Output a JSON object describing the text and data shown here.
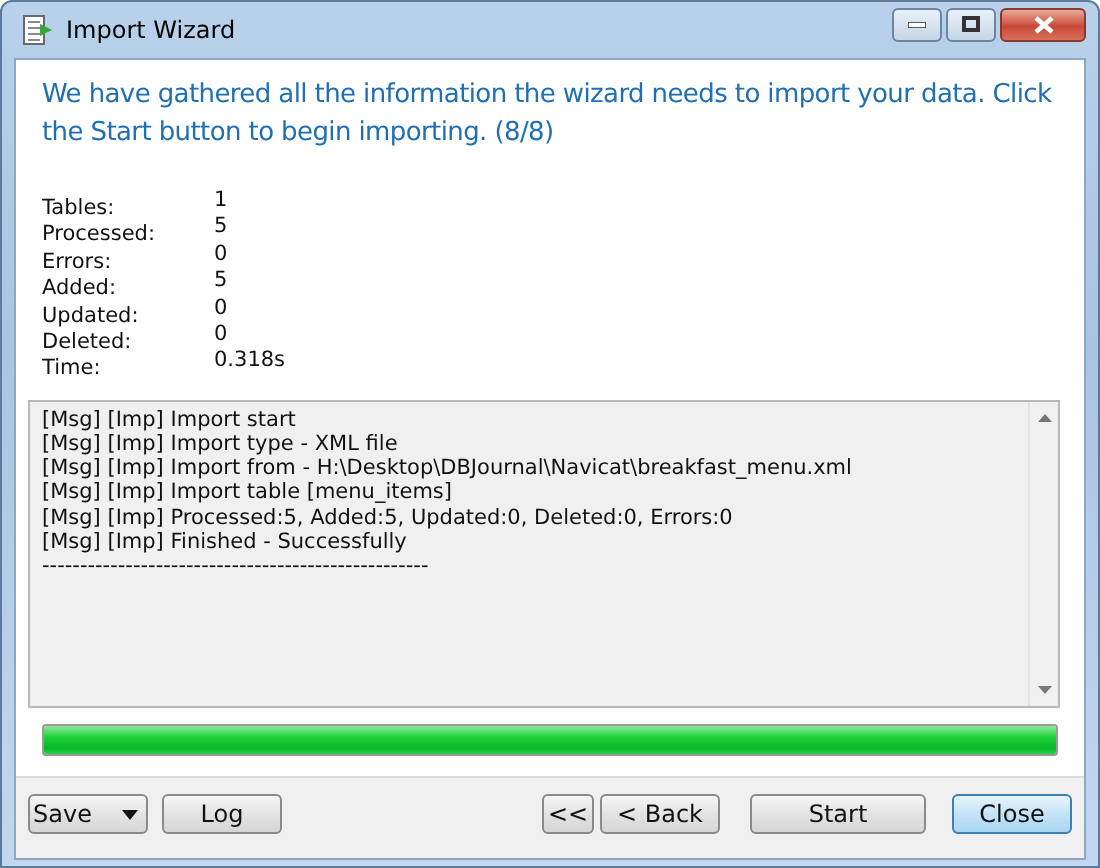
{
  "window": {
    "title": "Import Wizard"
  },
  "heading": "We have gathered all the information the wizard needs to import your data. Click the Start button to begin importing. (8/8)",
  "stats": [
    {
      "label": "Tables:",
      "value": "1"
    },
    {
      "label": "Processed:",
      "value": "5"
    },
    {
      "label": "Errors:",
      "value": "0"
    },
    {
      "label": "Added:",
      "value": "5"
    },
    {
      "label": "Updated:",
      "value": "0"
    },
    {
      "label": "Deleted:",
      "value": "0"
    },
    {
      "label": "Time:",
      "value": "0.318s"
    }
  ],
  "log": {
    "lines": [
      "[Msg] [Imp] Import start",
      "[Msg] [Imp] Import type - XML file",
      "[Msg] [Imp] Import from - H:\\Desktop\\DBJournal\\Navicat\\breakfast_menu.xml",
      "[Msg] [Imp] Import table [menu_items]",
      "[Msg] [Imp] Processed:5, Added:5, Updated:0, Deleted:0, Errors:0",
      "[Msg] [Imp] Finished - Successfully",
      "---------------------------------------------------"
    ]
  },
  "progress": {
    "level": 1
  },
  "buttons_left": [
    {
      "label": "Save",
      "kind": "split",
      "focused": false
    },
    {
      "label": "Log",
      "kind": "push",
      "focused": false
    }
  ],
  "buttons_right": [
    {
      "label": "<<",
      "kind": "push",
      "focused": false
    },
    {
      "label": "< Back",
      "kind": "push",
      "focused": false
    },
    {
      "label": "Start",
      "kind": "push",
      "focused": false
    },
    {
      "label": "Close",
      "kind": "push",
      "focused": true
    }
  ]
}
